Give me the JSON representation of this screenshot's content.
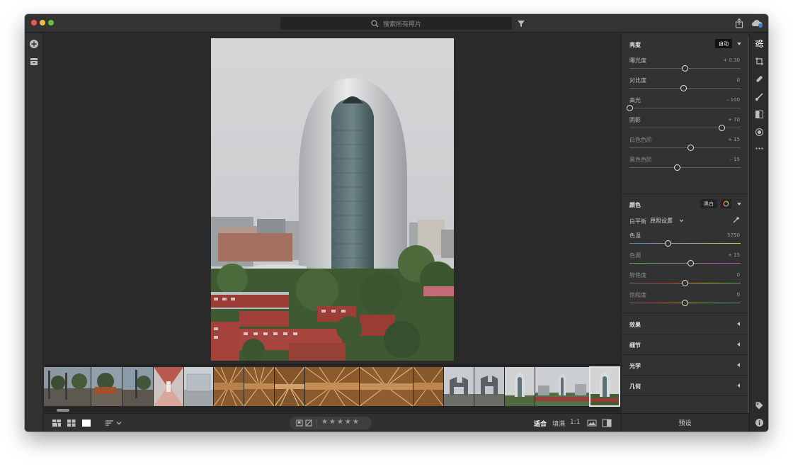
{
  "search": {
    "placeholder": "搜索所有照片"
  },
  "right_panel": {
    "light": {
      "title": "亮度",
      "auto_label": "自动",
      "sliders": [
        {
          "label": "曝光度",
          "value": "+ 0.30",
          "level": 0.5
        },
        {
          "label": "对比度",
          "value": "0",
          "level": 0.49
        },
        {
          "label": "高光",
          "value": "– 100",
          "level": 0.0
        },
        {
          "label": "阴影",
          "value": "+ 70",
          "level": 0.83
        },
        {
          "label": "白色色阶",
          "value": "+ 15",
          "level": 0.55
        },
        {
          "label": "黑色色阶",
          "value": "– 15",
          "level": 0.43
        }
      ]
    },
    "color": {
      "title": "颜色",
      "bw_label": "黑白",
      "wb_label": "白平衡",
      "wb_value": "原照设置",
      "sliders": [
        {
          "label": "色温",
          "value": "5750",
          "level": 0.35
        },
        {
          "label": "色调",
          "value": "+ 15",
          "level": 0.55
        },
        {
          "label": "鲜艳度",
          "value": "0",
          "level": 0.5
        },
        {
          "label": "饱和度",
          "value": "0",
          "level": 0.5
        }
      ]
    },
    "collapsed_sections": [
      "效果",
      "细节",
      "光学",
      "几何"
    ],
    "preset_label": "预设"
  },
  "bottom_bar": {
    "zoom_fit": "适合",
    "zoom_fill": "填满",
    "zoom_1to1": "1:1"
  },
  "colors": {
    "window_bg": "#2b2b2b",
    "panel_bg": "#323232",
    "accent_white": "#e8e8e8"
  }
}
